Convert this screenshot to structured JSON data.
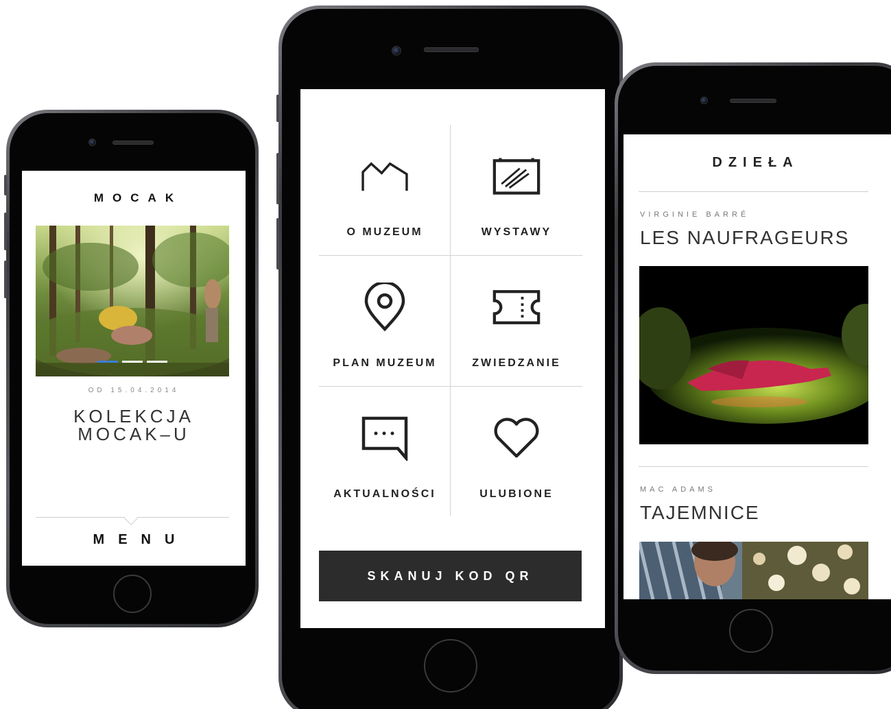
{
  "left_screen": {
    "logo": "MOCAK",
    "date": "OD 15.04.2014",
    "title_line1": "KOLEKCJA",
    "title_line2": "MOCAK–U",
    "menu": "MENU"
  },
  "menu_screen": {
    "items": [
      {
        "label": "O MUZEUM",
        "icon": "museum-roof-icon"
      },
      {
        "label": "WYSTAWY",
        "icon": "exhibition-canvas-icon"
      },
      {
        "label": "PLAN MUZEUM",
        "icon": "map-pin-icon"
      },
      {
        "label": "ZWIEDZANIE",
        "icon": "ticket-icon"
      },
      {
        "label": "AKTUALNOŚCI",
        "icon": "chat-bubble-icon"
      },
      {
        "label": "ULUBIONE",
        "icon": "heart-icon"
      }
    ],
    "qr_button": "SKANUJ KOD QR"
  },
  "works_screen": {
    "title": "DZIEŁA",
    "works": [
      {
        "artist": "VIRGINIE BARRÉ",
        "title": "LES NAUFRAGEURS"
      },
      {
        "artist": "MAC ADAMS",
        "title": "TAJEMNICE"
      }
    ]
  },
  "colors": {
    "button_bg": "#2c2c2c",
    "slider_active": "#3a7fd8",
    "phone_frame": "#3a3b3e"
  }
}
